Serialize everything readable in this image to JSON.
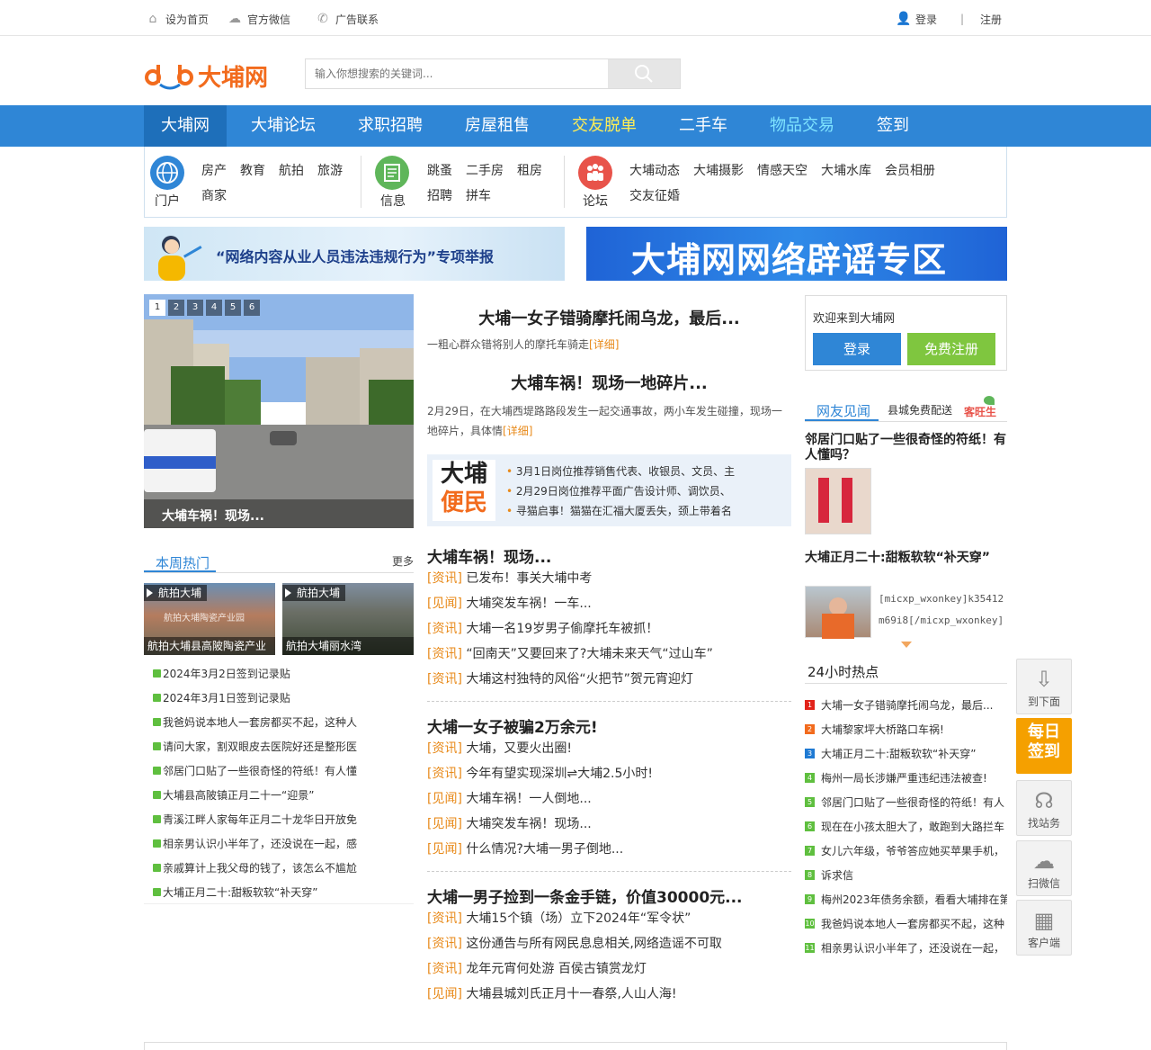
{
  "topbar": {
    "set_home": "设为首页",
    "wechat": "官方微信",
    "ad_contact": "广告联系",
    "login": "登录",
    "divider": "|",
    "register": "注册"
  },
  "header": {
    "logo_text": "大埔网",
    "search_placeholder": "输入你想搜索的关键词..."
  },
  "nav": {
    "items": [
      {
        "label": "大埔网",
        "color": "#ffffff"
      },
      {
        "label": "大埔论坛",
        "color": "#ffffff"
      },
      {
        "label": "求职招聘",
        "color": "#ffffff"
      },
      {
        "label": "房屋租售",
        "color": "#ffffff"
      },
      {
        "label": "交友脱单",
        "color": "#ffee55"
      },
      {
        "label": "二手车",
        "color": "#ffffff"
      },
      {
        "label": "物品交易",
        "color": "#7fe4ff"
      },
      {
        "label": "签到",
        "color": "#ffffff"
      }
    ]
  },
  "channels": {
    "portal": {
      "caption": "门户",
      "links": [
        "房产",
        "教育",
        "航拍",
        "旅游",
        "商家"
      ]
    },
    "info": {
      "caption": "信息",
      "links": [
        "跳蚤",
        "二手房",
        "租房",
        "招聘",
        "拼车"
      ]
    },
    "forum": {
      "caption": "论坛",
      "links": [
        "大埔动态",
        "大埔摄影",
        "情感天空",
        "大埔水库",
        "会员相册",
        "交友征婚"
      ]
    }
  },
  "banners": {
    "left_text": "“网络内容从业人员违法违规行为”专项举报",
    "right_text": "大埔网网络辟谣专区"
  },
  "slider": {
    "dots": [
      "1",
      "2",
      "3",
      "4",
      "5",
      "6"
    ],
    "caption": "大埔车祸！现场..."
  },
  "headlines": [
    {
      "title": "大埔一女子错骑摩托闹乌龙，最后...",
      "summary": "一粗心群众错将别人的摩托车骑走",
      "detail": "[详细]"
    },
    {
      "title": "大埔车祸！现场一地碎片...",
      "summary": "2月29日，在大埔西堤路路段发生一起交通事故，两小车发生碰撞，现场一地碎片，具体情",
      "detail": "[详细]"
    }
  ],
  "bianmin": {
    "logo_line1": "大埔",
    "logo_line2": "便民",
    "items": [
      "3月1日岗位推荐销售代表、收银员、文员、主",
      "2月29日岗位推荐平面广告设计师、调饮员、",
      "寻猫启事！猫猫在汇福大厦丢失，颈上带着名"
    ]
  },
  "news_groups": [
    {
      "title": "大埔车祸！现场...",
      "rows": [
        {
          "tag": "[资讯]",
          "text": "已发布！事关大埔中考"
        },
        {
          "tag": "[见闻]",
          "text": "大埔突发车祸！一车..."
        },
        {
          "tag": "[资讯]",
          "text": "大埔一名19岁男子偷摩托车被抓！"
        },
        {
          "tag": "[资讯]",
          "text": "“回南天”又要回来了?大埔未来天气“过山车”"
        },
        {
          "tag": "[资讯]",
          "text": "大埔这村独特的风俗“火把节”贺元宵迎灯"
        }
      ]
    },
    {
      "title": "大埔一女子被骗2万余元!",
      "rows": [
        {
          "tag": "[资讯]",
          "text": "大埔，又要火出圈!"
        },
        {
          "tag": "[资讯]",
          "text": "今年有望实现深圳⇌大埔2.5小时!"
        },
        {
          "tag": "[见闻]",
          "text": "大埔车祸！一人倒地..."
        },
        {
          "tag": "[见闻]",
          "text": "大埔突发车祸！现场..."
        },
        {
          "tag": "[见闻]",
          "text": "什么情况?大埔一男子倒地..."
        }
      ]
    },
    {
      "title": "大埔一男子捡到一条金手链，价值30000元...",
      "rows": [
        {
          "tag": "[资讯]",
          "text": "大埔15个镇（场）立下2024年“军令状”"
        },
        {
          "tag": "[资讯]",
          "text": "这份通告与所有网民息息相关,网络造谣不可取"
        },
        {
          "tag": "[资讯]",
          "text": "龙年元宵何处游 百侯古镇赏龙灯"
        },
        {
          "tag": "[见闻]",
          "text": "大埔县城刘氏正月十一春祭,人山人海!"
        }
      ]
    }
  ],
  "hot_week": {
    "title": "本周热门",
    "more": "更多",
    "thumbs": [
      {
        "badge": "航拍大埔",
        "caption": "航拍大埔县高陂陶瓷产业",
        "overlay": "航拍大埔陶瓷产业园"
      },
      {
        "badge": "航拍大埔",
        "caption": "航拍大埔丽水湾",
        "overlay": ""
      }
    ],
    "items": [
      "2024年3月2日签到记录贴",
      "2024年3月1日签到记录贴",
      "我爸妈说本地人一套房都买不起，这种人",
      "请问大家，割双眼皮去医院好还是整形医",
      "邻居门口贴了一些很奇怪的符纸！有人懂",
      "大埔县高陂镇正月二十一“迎景”",
      "青溪江畔人家每年正月二十龙华日开放免",
      "相亲男认识小半年了，还没说在一起，感",
      "亲戚算计上我父母的钱了，该怎么不尴尬",
      "大埔正月二十:甜粄软软“补天穿”"
    ]
  },
  "right": {
    "welcome": "欢迎来到大埔网",
    "login_btn": "登录",
    "register_btn": "免费注册",
    "tab_active": "网友见闻",
    "tab_other": "县城免费配送",
    "brand_logo": "客旺生",
    "posts": [
      {
        "title": "邻居门口贴了一些很奇怪的符纸！有人懂吗？",
        "excerpt": ""
      },
      {
        "title": "大埔正月二十:甜粄软软“补天穿”",
        "excerpt": "[micxp_wxonkey]k35412m69i8[/micxp_wxonkey]来源：大埔县融媒体中心"
      }
    ],
    "rank_title": "24小时热点",
    "rank": [
      {
        "n": "1",
        "color": "#e2231a",
        "text": "大埔一女子错骑摩托闹乌龙，最后..."
      },
      {
        "n": "2",
        "color": "#f26b1d",
        "text": "大埔黎家坪大桥路口车祸!"
      },
      {
        "n": "3",
        "color": "#1f7ad3",
        "text": "大埔正月二十:甜粄软软“补天穿”"
      },
      {
        "n": "4",
        "color": "#5fbf3f",
        "text": "梅州一局长涉嫌严重违纪违法被查!"
      },
      {
        "n": "5",
        "color": "#5fbf3f",
        "text": "邻居门口贴了一些很奇怪的符纸！有人"
      },
      {
        "n": "6",
        "color": "#5fbf3f",
        "text": "现在在小孩太胆大了，敢跑到大路拦车"
      },
      {
        "n": "7",
        "color": "#5fbf3f",
        "text": "女儿六年级，爷爷答应她买苹果手机，"
      },
      {
        "n": "8",
        "color": "#5fbf3f",
        "text": "诉求信"
      },
      {
        "n": "9",
        "color": "#5fbf3f",
        "text": "梅州2023年债务余额，看看大埔排在第"
      },
      {
        "n": "10",
        "color": "#5fbf3f",
        "text": "我爸妈说本地人一套房都买不起，这种"
      },
      {
        "n": "11",
        "color": "#5fbf3f",
        "text": "相亲男认识小半年了，还没说在一起，"
      }
    ]
  },
  "float": {
    "bottom": "到下面",
    "signin_line1": "每日",
    "signin_line2": "签到",
    "service": "找站务",
    "wechat": "扫微信",
    "client": "客户端"
  }
}
